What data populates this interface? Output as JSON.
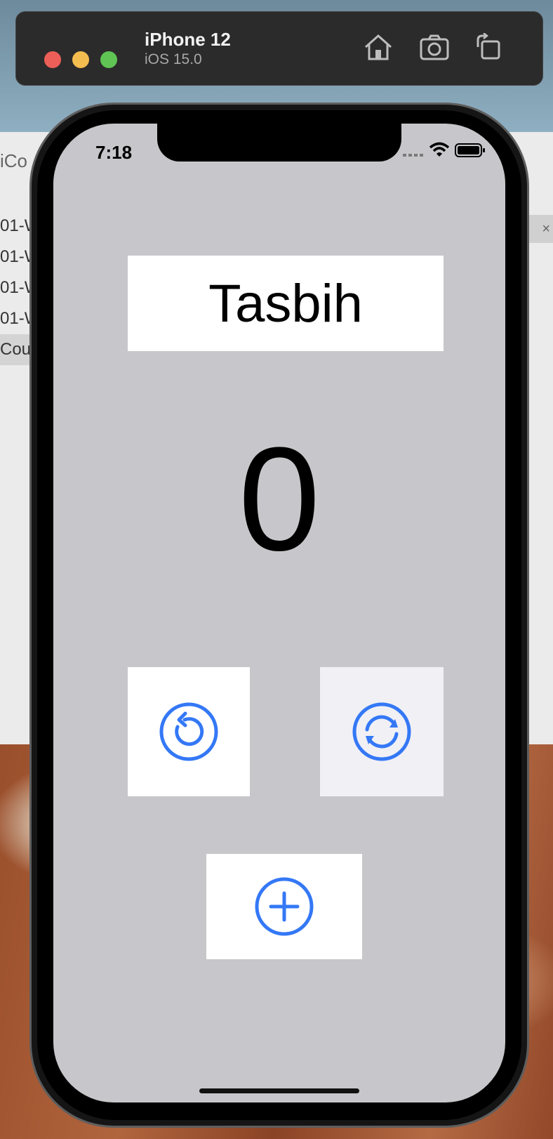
{
  "simulator": {
    "device_name": "iPhone 12",
    "os_version": "iOS 15.0",
    "toolbar_icons": [
      "home-icon",
      "screenshot-icon",
      "rotate-icon"
    ]
  },
  "background_window": {
    "partial_title": "iCo",
    "rows": [
      "01-W",
      "01-W",
      "01-W",
      "01-W",
      "Cou"
    ],
    "tab_close": "×"
  },
  "status_bar": {
    "time": "7:18",
    "icons": [
      "signal-icon",
      "wifi-icon",
      "battery-icon"
    ]
  },
  "app": {
    "title": "Tasbih",
    "count": "0",
    "buttons": {
      "undo": {
        "icon": "undo-circle-icon"
      },
      "reset": {
        "icon": "reset-circle-icon"
      },
      "increment": {
        "icon": "plus-circle-icon"
      }
    },
    "accent_color": "#3478f6"
  }
}
